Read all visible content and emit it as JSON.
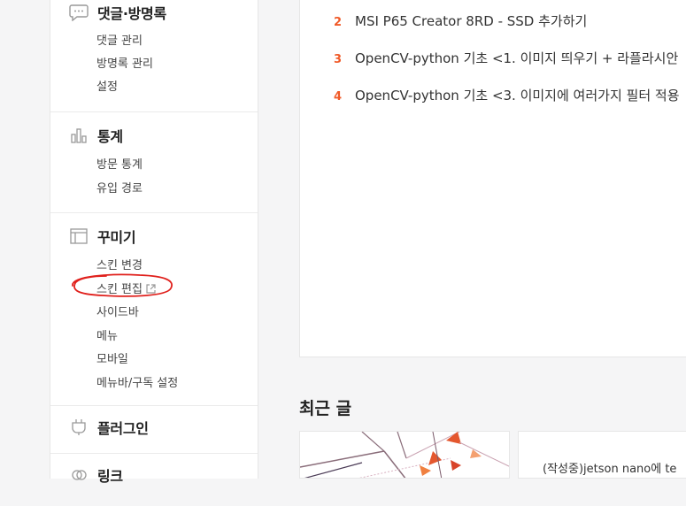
{
  "sidebar": {
    "sections": [
      {
        "title": "댓글·방명록",
        "icon": "chat-bubble-icon",
        "items": [
          "댓글 관리",
          "방명록 관리",
          "설정"
        ]
      },
      {
        "title": "통계",
        "icon": "bar-chart-icon",
        "items": [
          "방문 통계",
          "유입 경로"
        ]
      },
      {
        "title": "꾸미기",
        "icon": "layout-icon",
        "items": [
          "스킨 변경",
          "스킨 편집",
          "사이드바",
          "메뉴",
          "모바일",
          "메뉴바/구독 설정"
        ]
      },
      {
        "title": "플러그인",
        "icon": "plug-icon",
        "items": []
      },
      {
        "title": "링크",
        "icon": "link-icon",
        "items": []
      }
    ]
  },
  "popular_posts": [
    {
      "rank": "2",
      "title": "MSI P65 Creator 8RD - SSD 추가하기"
    },
    {
      "rank": "3",
      "title": "OpenCV-python 기초 <1. 이미지 띄우기 + 라플라시안"
    },
    {
      "rank": "4",
      "title": "OpenCV-python 기초 <3. 이미지에 여러가지 필터 적용"
    }
  ],
  "recent": {
    "heading": "최근 글",
    "second_post_title": "(작성중)jetson nano에 te"
  },
  "colors": {
    "rank": "#f05a28",
    "annotation": "#e0201c"
  }
}
